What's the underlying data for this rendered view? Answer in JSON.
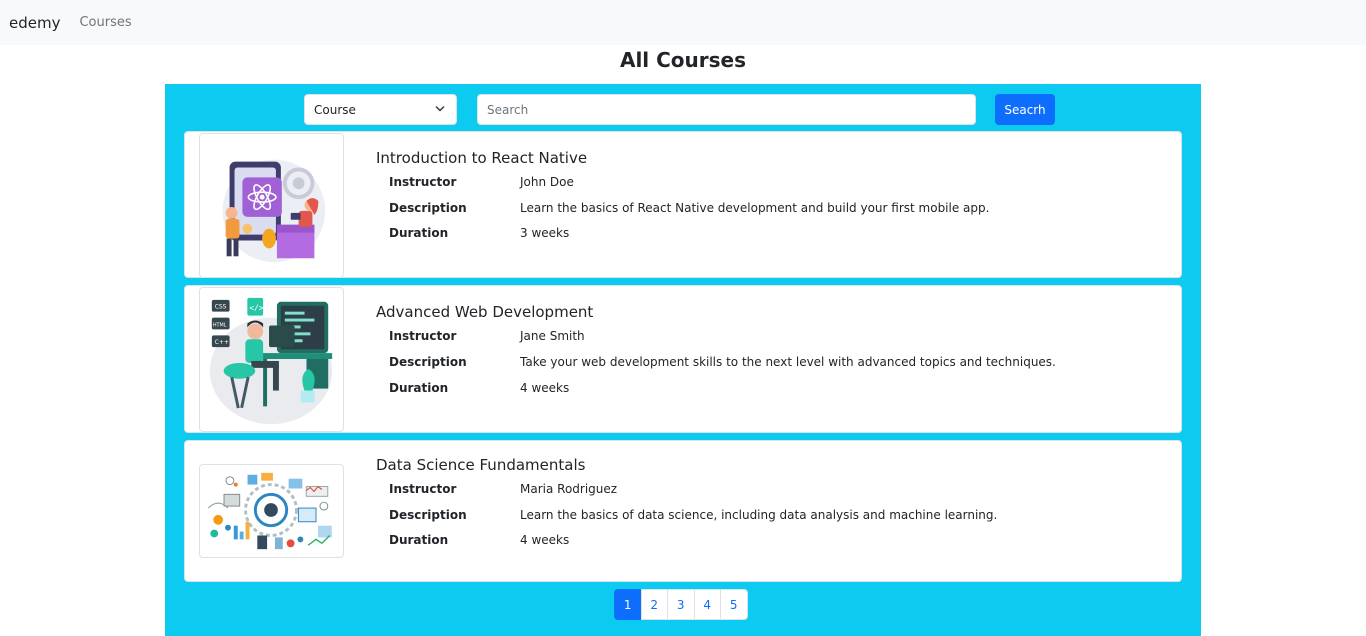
{
  "navbar": {
    "brand": "edemy",
    "links": [
      "Courses"
    ]
  },
  "page": {
    "title": "All Courses"
  },
  "filters": {
    "select_value": "Course",
    "search_placeholder": "Search",
    "search_button": "Seacrh"
  },
  "labels": {
    "instructor": "Instructor",
    "description": "Description",
    "duration": "Duration"
  },
  "courses": [
    {
      "title": "Introduction to React Native",
      "instructor": "John Doe",
      "description": "Learn the basics of React Native development and build your first mobile app.",
      "duration": "3 weeks",
      "image_icon": "react-native-illustration-icon"
    },
    {
      "title": "Advanced Web Development",
      "instructor": "Jane Smith",
      "description": "Take your web development skills to the next level with advanced topics and techniques.",
      "duration": "4 weeks",
      "image_icon": "web-developer-illustration-icon"
    },
    {
      "title": "Data Science Fundamentals",
      "instructor": "Maria Rodriguez",
      "description": "Learn the basics of data science, including data analysis and machine learning.",
      "duration": "4 weeks",
      "image_icon": "data-science-illustration-icon"
    }
  ],
  "pagination": {
    "pages": [
      "1",
      "2",
      "3",
      "4",
      "5"
    ],
    "current": "1"
  },
  "colors": {
    "main_background": "#0dcaf0",
    "primary": "#0d6efd",
    "navbar_background": "#f8f9fa"
  }
}
